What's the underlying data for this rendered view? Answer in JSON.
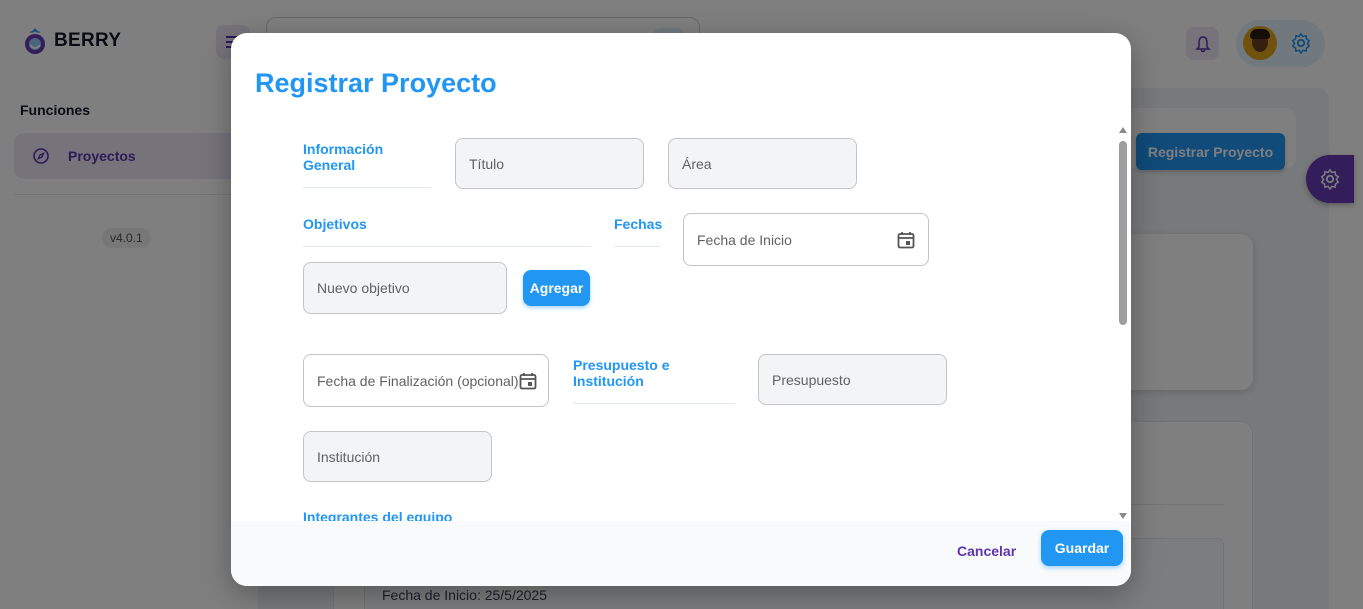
{
  "app": {
    "brand": "BERRY",
    "sidebar": {
      "heading": "Funciones",
      "items": [
        {
          "label": "Proyectos"
        }
      ],
      "version": "v4.0.1"
    },
    "main": {
      "register_button": "Registrar Proyecto",
      "card_start_date": "Fecha de Inicio: 25/5/2025"
    }
  },
  "modal": {
    "title": "Registrar Proyecto",
    "sections": {
      "general": "Información General",
      "objectives": "Objetivos",
      "dates": "Fechas",
      "budget": "Presupuesto e Institución",
      "team": "Integrantes del equipo"
    },
    "fields": {
      "title": "Título",
      "area": "Área",
      "start_date": "Fecha de Inicio",
      "new_objective": "Nuevo objetivo",
      "end_date": "Fecha de Finalización (opcional)",
      "budget": "Presupuesto",
      "institution": "Institución"
    },
    "buttons": {
      "add": "Agregar",
      "cancel": "Cancelar",
      "save": "Guardar"
    }
  },
  "colors": {
    "primary": "#2196f3",
    "secondary": "#5e35b1",
    "overlay": "rgba(0,0,0,0.5)"
  },
  "icons": [
    "berry-logo-icon",
    "menu-icon",
    "tune-icon",
    "bell-icon",
    "gear-icon",
    "project-icon",
    "calendar-icon"
  ]
}
